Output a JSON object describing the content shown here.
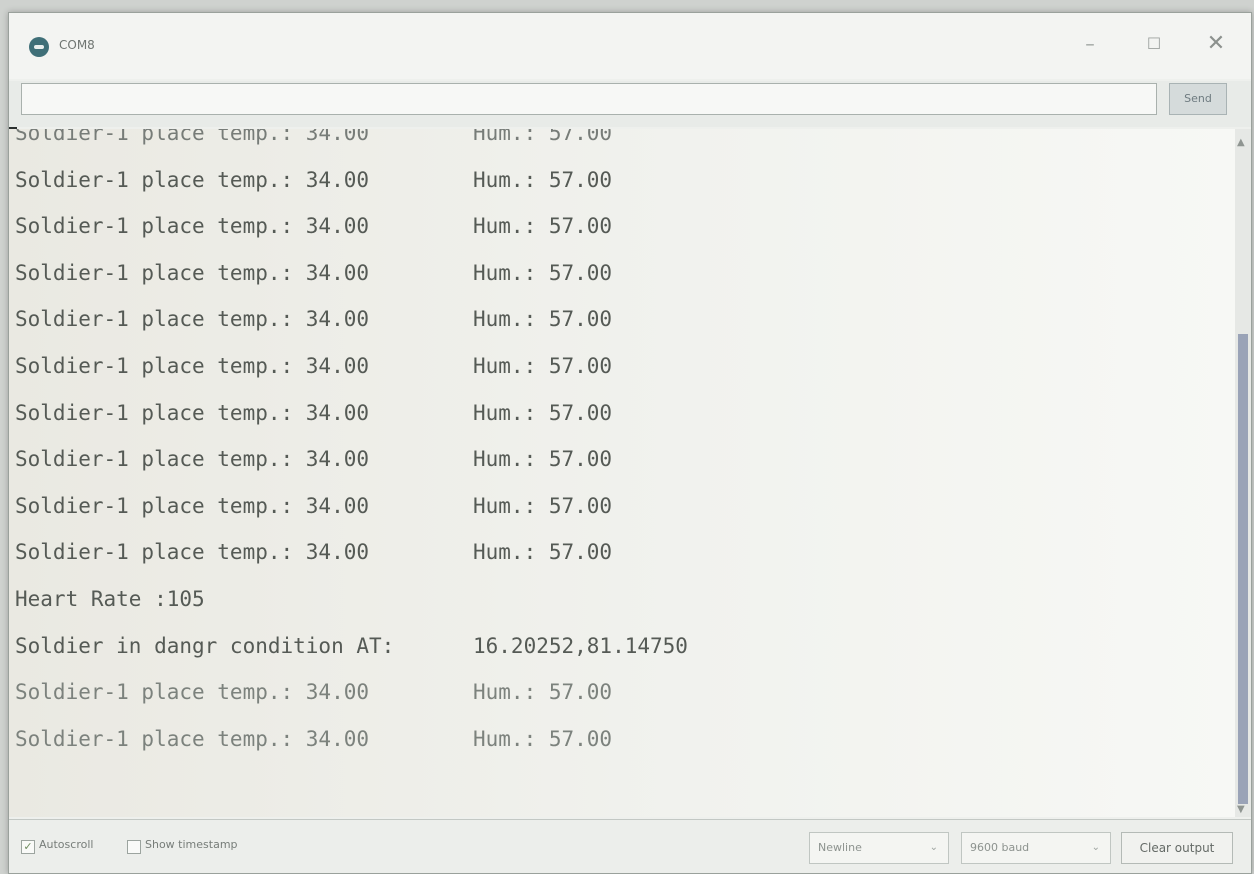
{
  "window": {
    "title": "COM8",
    "minimize_glyph": "–",
    "maximize_glyph": "☐",
    "close_glyph": "✕"
  },
  "send": {
    "input_value": "",
    "button_label": "Send"
  },
  "output_lines": [
    {
      "left": "Soldier-1 place temp.: 34.00",
      "right": "Hum.: 57.00"
    },
    {
      "left": "Soldier-1 place temp.: 34.00",
      "right": "Hum.: 57.00"
    },
    {
      "left": "Soldier-1 place temp.: 34.00",
      "right": "Hum.: 57.00"
    },
    {
      "left": "Soldier-1 place temp.: 34.00",
      "right": "Hum.: 57.00"
    },
    {
      "left": "Soldier-1 place temp.: 34.00",
      "right": "Hum.: 57.00"
    },
    {
      "left": "Soldier-1 place temp.: 34.00",
      "right": "Hum.: 57.00"
    },
    {
      "left": "Soldier-1 place temp.: 34.00",
      "right": "Hum.: 57.00"
    },
    {
      "left": "Soldier-1 place temp.: 34.00",
      "right": "Hum.: 57.00"
    },
    {
      "left": "Soldier-1 place temp.: 34.00",
      "right": "Hum.: 57.00"
    },
    {
      "left": "Soldier-1 place temp.: 34.00",
      "right": "Hum.: 57.00"
    },
    {
      "left": "Heart Rate :105",
      "right": ""
    },
    {
      "left": "Soldier in dangr condition AT:",
      "right": "16.20252,81.14750"
    },
    {
      "left": "Soldier-1 place temp.: 34.00",
      "right": "Hum.: 57.00"
    },
    {
      "left": "Soldier-1 place temp.: 34.00",
      "right": "Hum.: 57.00"
    }
  ],
  "footer": {
    "autoscroll_label": "Autoscroll",
    "autoscroll_checked": true,
    "timestamp_label": "Show timestamp",
    "timestamp_checked": false,
    "line_ending": "Newline",
    "baud_rate": "9600 baud",
    "clear_label": "Clear output"
  },
  "icons": {
    "app": "arduino-icon",
    "scroll_up": "chevron-up-icon",
    "scroll_down": "chevron-down-icon",
    "dropdown": "chevron-down-icon"
  }
}
